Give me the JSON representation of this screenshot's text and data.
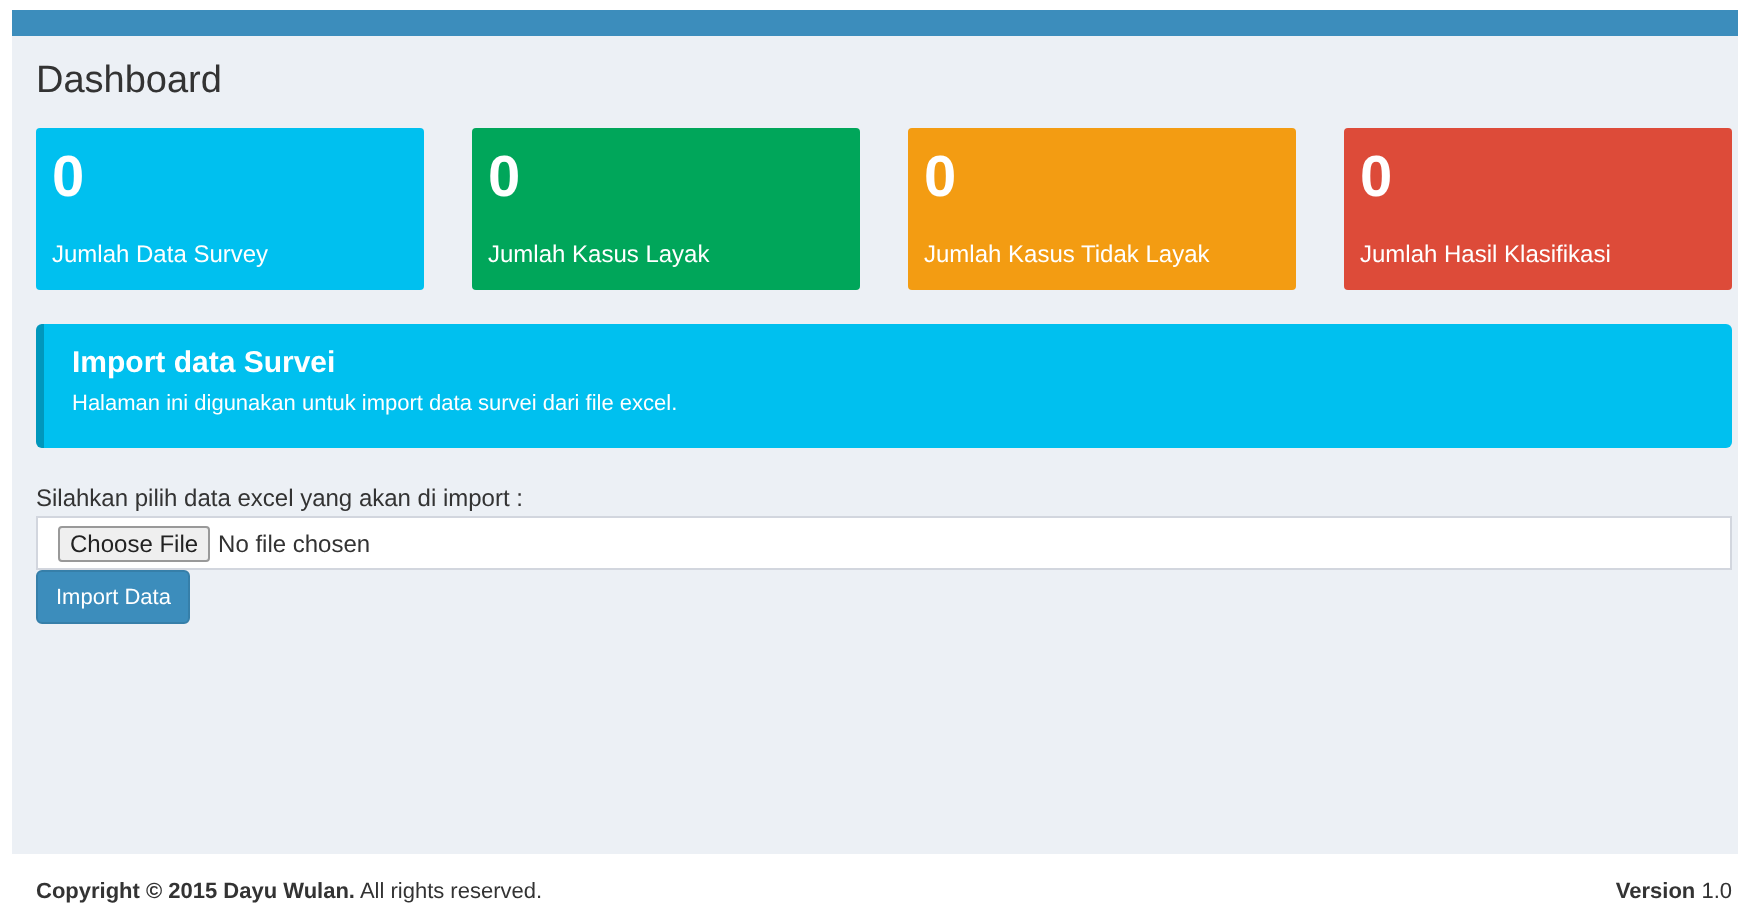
{
  "page_title": "Dashboard",
  "stat_cards": [
    {
      "value": "0",
      "label": "Jumlah Data Survey",
      "color": "#00c0ef"
    },
    {
      "value": "0",
      "label": "Jumlah Kasus Layak",
      "color": "#00a65a"
    },
    {
      "value": "0",
      "label": "Jumlah Kasus Tidak Layak",
      "color": "#f39c12"
    },
    {
      "value": "0",
      "label": "Jumlah Hasil Klasifikasi",
      "color": "#dd4b39"
    }
  ],
  "callout": {
    "title": "Import data Survei",
    "text": "Halaman ini digunakan untuk import data survei dari file excel."
  },
  "form": {
    "label": "Silahkan pilih data excel yang akan di import :",
    "file_button": "Choose File",
    "file_status": "No file chosen",
    "submit": "Import Data"
  },
  "footer": {
    "copyright": "**Copyright © 2015 Dayu Wulan.** All rights reserved.",
    "version": "**Version** 1.0"
  }
}
